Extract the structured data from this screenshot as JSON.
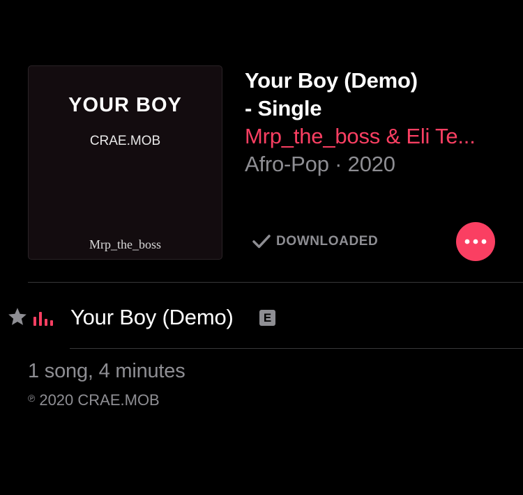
{
  "album": {
    "artwork": {
      "title": "YOUR BOY",
      "artist": "CRAE.MOB",
      "signature": "Mrp_the_boss"
    },
    "title_line1": "Your Boy (Demo)",
    "title_line2": "- Single",
    "artists": "Mrp_the_boss & Eli Te...",
    "genre_year": "Afro-Pop · 2020",
    "download_status": "DOWNLOADED",
    "more_icon": "ellipsis-icon"
  },
  "tracks": [
    {
      "title": "Your Boy (Demo)",
      "explicit_badge": "E",
      "rating_icon": "star-icon",
      "playing_icon": "now-playing-bars-icon"
    }
  ],
  "footer": {
    "summary": "1 song, 4 minutes",
    "copyright_symbol": "℗",
    "copyright_text": "2020 CRAE.MOB"
  },
  "colors": {
    "accent": "#fa3f62",
    "secondary_text": "#8e8e93",
    "background": "#000000",
    "divider": "#38383a"
  }
}
